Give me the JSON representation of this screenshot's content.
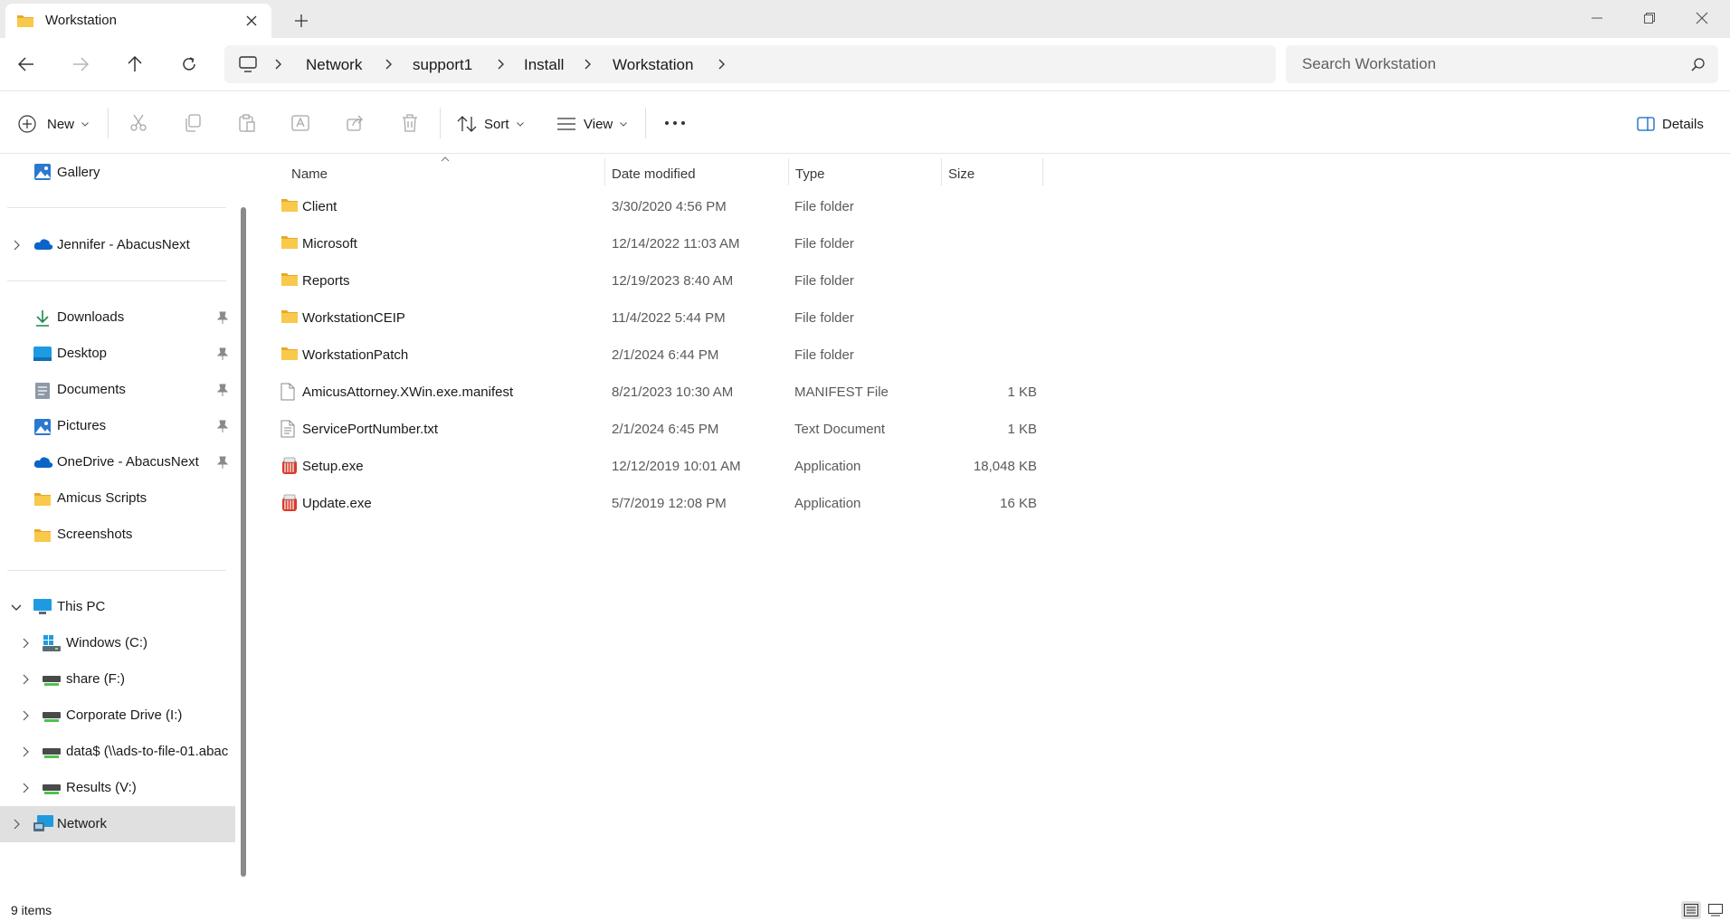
{
  "window": {
    "tab_title": "Workstation",
    "controls": [
      "minimize",
      "restore",
      "close"
    ]
  },
  "address": {
    "crumbs": [
      "Network",
      "support1",
      "Install",
      "Workstation"
    ],
    "search_placeholder": "Search Workstation"
  },
  "commandbar": {
    "new_label": "New",
    "sort_label": "Sort",
    "view_label": "View",
    "details_label": "Details"
  },
  "sidebar": {
    "gallery": "Gallery",
    "onedrive_personal": "Jennifer - AbacusNext",
    "quick_access": [
      {
        "label": "Downloads",
        "icon": "download-icon",
        "pinned": true
      },
      {
        "label": "Desktop",
        "icon": "desktop-icon",
        "pinned": true
      },
      {
        "label": "Documents",
        "icon": "documents-icon",
        "pinned": true
      },
      {
        "label": "Pictures",
        "icon": "pictures-icon",
        "pinned": true
      },
      {
        "label": "OneDrive - AbacusNext",
        "icon": "cloud-icon",
        "pinned": true
      },
      {
        "label": "Amicus Scripts",
        "icon": "folder-icon",
        "pinned": false
      },
      {
        "label": "Screenshots",
        "icon": "folder-icon",
        "pinned": false
      }
    ],
    "this_pc": "This PC",
    "drives": [
      {
        "label": "Windows (C:)",
        "icon": "windows-drive-icon"
      },
      {
        "label": "share (F:)",
        "icon": "network-drive-icon"
      },
      {
        "label": "Corporate Drive (I:)",
        "icon": "network-drive-icon"
      },
      {
        "label": "data$ (\\\\ads-to-file-01.abac",
        "icon": "network-drive-icon"
      },
      {
        "label": "Results (V:)",
        "icon": "network-drive-icon"
      }
    ],
    "network": "Network"
  },
  "columns": {
    "name": "Name",
    "date": "Date modified",
    "type": "Type",
    "size": "Size"
  },
  "files": [
    {
      "name": "Client",
      "date": "3/30/2020 4:56 PM",
      "type": "File folder",
      "size": "",
      "icon": "folder-icon"
    },
    {
      "name": "Microsoft",
      "date": "12/14/2022 11:03 AM",
      "type": "File folder",
      "size": "",
      "icon": "folder-icon"
    },
    {
      "name": "Reports",
      "date": "12/19/2023 8:40 AM",
      "type": "File folder",
      "size": "",
      "icon": "folder-icon"
    },
    {
      "name": "WorkstationCEIP",
      "date": "11/4/2022 5:44 PM",
      "type": "File folder",
      "size": "",
      "icon": "folder-icon"
    },
    {
      "name": "WorkstationPatch",
      "date": "2/1/2024 6:44 PM",
      "type": "File folder",
      "size": "",
      "icon": "folder-icon"
    },
    {
      "name": "AmicusAttorney.XWin.exe.manifest",
      "date": "8/21/2023 10:30 AM",
      "type": "MANIFEST File",
      "size": "1 KB",
      "icon": "file-icon"
    },
    {
      "name": "ServicePortNumber.txt",
      "date": "2/1/2024 6:45 PM",
      "type": "Text Document",
      "size": "1 KB",
      "icon": "text-file-icon"
    },
    {
      "name": "Setup.exe",
      "date": "12/12/2019 10:01 AM",
      "type": "Application",
      "size": "18,048 KB",
      "icon": "installer-icon"
    },
    {
      "name": "Update.exe",
      "date": "5/7/2019 12:08 PM",
      "type": "Application",
      "size": "16 KB",
      "icon": "installer-icon"
    }
  ],
  "status": {
    "item_count": "9 items"
  },
  "colors": {
    "folder": "#f8c94a",
    "folder_dark": "#e7a92a",
    "accent": "#0a64c8",
    "selected_bg": "#e0e0e0"
  }
}
